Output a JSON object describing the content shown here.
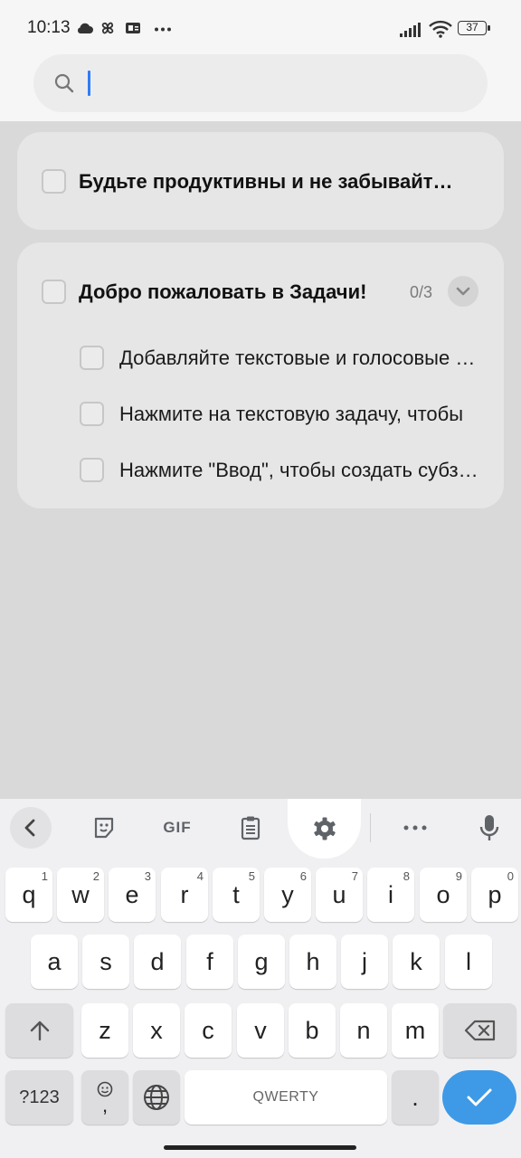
{
  "status_bar": {
    "time": "10:13",
    "battery": "37"
  },
  "search": {
    "placeholder": "",
    "value": ""
  },
  "tasks": [
    {
      "title": "Будьте продуктивны и не забывайт…",
      "checked": false
    }
  ],
  "group": {
    "title": "Добро пожаловать в Задачи!",
    "count": "0/3",
    "subtasks": [
      {
        "text": "Добавляйте текстовые и голосовые задачи"
      },
      {
        "text": "Нажмите на текстовую задачу, чтобы"
      },
      {
        "text": "Нажмите \"Ввод\", чтобы создать субзадачу"
      }
    ]
  },
  "keyboard": {
    "toolbar": {
      "gif_label": "GIF"
    },
    "row1": [
      {
        "label": "q",
        "hint": "1"
      },
      {
        "label": "w",
        "hint": "2"
      },
      {
        "label": "e",
        "hint": "3"
      },
      {
        "label": "r",
        "hint": "4"
      },
      {
        "label": "t",
        "hint": "5"
      },
      {
        "label": "y",
        "hint": "6"
      },
      {
        "label": "u",
        "hint": "7"
      },
      {
        "label": "i",
        "hint": "8"
      },
      {
        "label": "o",
        "hint": "9"
      },
      {
        "label": "p",
        "hint": "0"
      }
    ],
    "row2": [
      "a",
      "s",
      "d",
      "f",
      "g",
      "h",
      "j",
      "k",
      "l"
    ],
    "row3": [
      "z",
      "x",
      "c",
      "v",
      "b",
      "n",
      "m"
    ],
    "symbols_label": "?123",
    "comma_label": ",",
    "space_label": "QWERTY",
    "period_label": "."
  }
}
